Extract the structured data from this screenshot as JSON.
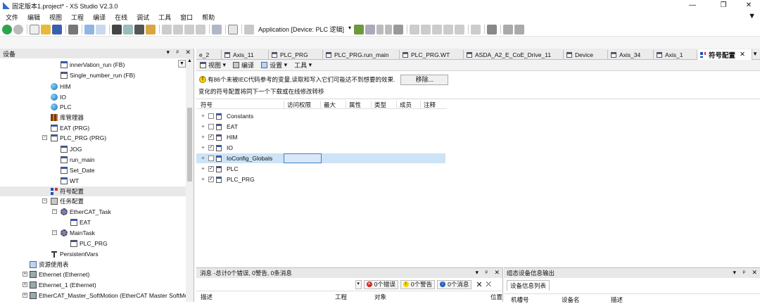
{
  "window": {
    "title": "固定版本1.project* - XS Studio V2.3.0",
    "controls": [
      "—",
      "❐",
      "✕"
    ]
  },
  "menubar": {
    "items": [
      "文件",
      "编辑",
      "视图",
      "工程",
      "编译",
      "在线",
      "调试",
      "工具",
      "窗口",
      "帮助"
    ]
  },
  "toolbar": {
    "app_device": "Application [Device: PLC 逻辑]"
  },
  "left_panel": {
    "title": "设备",
    "header_buttons": [
      "▾",
      "ᵖ",
      "✕"
    ],
    "tree": [
      {
        "label": "innerVation_run (FB)",
        "icon": "doc"
      },
      {
        "label": "Single_number_run (FB)",
        "icon": "doc"
      },
      {
        "label": "HIM",
        "icon": "globe"
      },
      {
        "label": "IO",
        "icon": "globe"
      },
      {
        "label": "PLC",
        "icon": "globe"
      },
      {
        "label": "库管理器",
        "icon": "lib"
      },
      {
        "label": "EAT (PRG)",
        "icon": "doc"
      },
      {
        "label": "PLC_PRG (PRG)",
        "icon": "doc"
      },
      {
        "label": "JOG",
        "icon": "doc"
      },
      {
        "label": "run_main",
        "icon": "doc"
      },
      {
        "label": "Set_Date",
        "icon": "doc"
      },
      {
        "label": "WT",
        "icon": "doc"
      },
      {
        "label": "符号配置",
        "icon": "sym"
      },
      {
        "label": "任务配置",
        "icon": "task"
      },
      {
        "label": "EtherCAT_Task",
        "icon": "gear"
      },
      {
        "label": "EAT",
        "icon": "doc"
      },
      {
        "label": "MainTask",
        "icon": "gear"
      },
      {
        "label": "PLC_PRG",
        "icon": "doc"
      },
      {
        "label": "PersistentVars",
        "icon": "tee"
      },
      {
        "label": "资源使用表",
        "icon": "res"
      },
      {
        "label": "Ethernet (Ethernet)",
        "icon": "eth"
      },
      {
        "label": "Ethernet_1 (Ethernet)",
        "icon": "eth"
      },
      {
        "label": "EtherCAT_Master_SoftMotion (EtherCAT Master SoftMotion)",
        "icon": "eth"
      }
    ]
  },
  "tabs": [
    {
      "label": "e_2"
    },
    {
      "label": "Axis_11"
    },
    {
      "label": "PLC_PRG"
    },
    {
      "label": "PLC_PRG.run_main"
    },
    {
      "label": "PLC_PRG.WT"
    },
    {
      "label": "ASDA_A2_E_CoE_Drive_11"
    },
    {
      "label": "Device"
    },
    {
      "label": "Axis_34"
    },
    {
      "label": "Axis_1"
    },
    {
      "label": "符号配置",
      "close": "✕"
    }
  ],
  "editor_toolbar": {
    "view": "视图",
    "compile": "编译",
    "settings": "设置",
    "tools": "工具"
  },
  "warning": {
    "text": "有86个未被IEC代码参考的变量,读取和写入它们可能达不到想要的效果.",
    "button": "移除..."
  },
  "info": "变化的符号配置将同下一个下载或在线修改转移",
  "symbol_table": {
    "columns": [
      "符号",
      "访问权限",
      "最大",
      "属性",
      "类型",
      "成员",
      "注释"
    ],
    "rows": [
      {
        "name": "Constants",
        "checked": ""
      },
      {
        "name": "EAT",
        "checked": ""
      },
      {
        "name": "HIM",
        "checked": "✓"
      },
      {
        "name": "IO",
        "checked": "✓"
      },
      {
        "name": "IoConfig_Globals",
        "checked": ""
      },
      {
        "name": "PLC",
        "checked": "✓"
      },
      {
        "name": "PLC_PRG",
        "checked": "✓"
      }
    ]
  },
  "messages": {
    "title": "消息 -总计0个错误, 0警告, 0条消息",
    "errors": "0个错误",
    "warnings": "0个警告",
    "infos": "0个消息",
    "columns": [
      "描述",
      "工程",
      "对象",
      "位置"
    ]
  },
  "device_panel": {
    "title": "组态设备信息输出",
    "tab": "设备信息列表",
    "columns": [
      "机槽号",
      "设备名",
      "描述"
    ]
  },
  "colors": {
    "selection": "#cde3f6",
    "error": "#d9261c",
    "warning": "#f4d300",
    "info": "#1f5fbf"
  }
}
